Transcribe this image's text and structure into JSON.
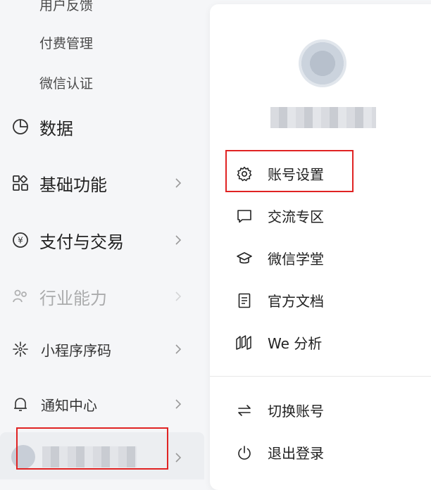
{
  "sidebar": {
    "subitems": [
      "用户反馈",
      "付费管理",
      "微信认证"
    ],
    "data_label": "数据",
    "basic_label": "基础功能",
    "pay_label": "支付与交易",
    "industry_label": "行业能力",
    "qrcode_label": "小程序序码",
    "notice_label": "通知中心"
  },
  "menu": {
    "account_settings": "账号设置",
    "community": "交流专区",
    "academy": "微信学堂",
    "docs": "官方文档",
    "we_analysis": "We 分析",
    "switch_account": "切换账号",
    "logout": "退出登录"
  },
  "colors": {
    "highlight": "#e02323",
    "panel_bg": "#ffffff",
    "sidebar_bg": "#f5f6f8"
  },
  "icons": [
    "pie-chart-icon",
    "grid-icon",
    "yuan-circle-icon",
    "people-icon",
    "qrcode-spark-icon",
    "bell-icon",
    "gear-icon",
    "chat-bubble-icon",
    "grad-cap-icon",
    "document-icon",
    "we-chart-icon",
    "switch-arrows-icon",
    "power-icon",
    "chevron-right-icon"
  ]
}
